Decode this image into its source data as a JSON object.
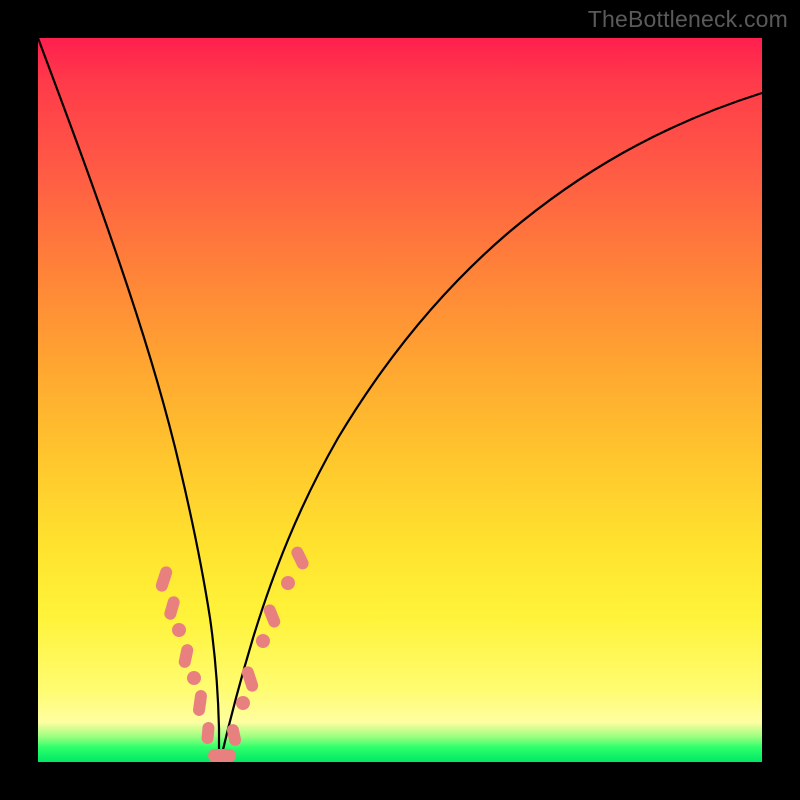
{
  "watermark": "TheBottleneck.com",
  "colors": {
    "frame": "#000000",
    "curve": "#000000",
    "marker": "#e98080",
    "gradient_stops": [
      "#ff1f4e",
      "#ff3a4a",
      "#ff5a45",
      "#ff8239",
      "#ffa531",
      "#ffc62d",
      "#ffe22e",
      "#fff33a",
      "#fffc71",
      "#fffea0",
      "#9bff80",
      "#2dff6b",
      "#00e865"
    ]
  },
  "chart_data": {
    "type": "line",
    "title": "",
    "xlabel": "",
    "ylabel": "",
    "xlim": [
      0,
      100
    ],
    "ylim": [
      0,
      100
    ],
    "x": [
      0,
      2,
      4,
      6,
      8,
      10,
      12,
      14,
      16,
      18,
      19,
      20,
      21,
      22,
      23,
      24,
      25,
      26,
      27,
      28,
      30,
      32,
      35,
      40,
      45,
      50,
      55,
      60,
      65,
      70,
      75,
      80,
      85,
      90,
      95,
      100
    ],
    "y": [
      100,
      88,
      77,
      67,
      58,
      50,
      42,
      35,
      28,
      21,
      18,
      15,
      12,
      9,
      6,
      3,
      0,
      3,
      6,
      9,
      14,
      19,
      25,
      34,
      42,
      48,
      54,
      59,
      63,
      67,
      71,
      74,
      77,
      80,
      82.5,
      85
    ],
    "minimum_x": 25,
    "highlighted_points": [
      {
        "x": 17.0,
        "y": 26
      },
      {
        "x": 18.0,
        "y": 22
      },
      {
        "x": 19.0,
        "y": 18
      },
      {
        "x": 20.0,
        "y": 14
      },
      {
        "x": 21.0,
        "y": 11
      },
      {
        "x": 22.5,
        "y": 7
      },
      {
        "x": 23.5,
        "y": 3
      },
      {
        "x": 25.0,
        "y": 0
      },
      {
        "x": 26.5,
        "y": 3
      },
      {
        "x": 28.0,
        "y": 8
      },
      {
        "x": 29.0,
        "y": 12
      },
      {
        "x": 30.5,
        "y": 16
      },
      {
        "x": 32.0,
        "y": 20
      },
      {
        "x": 34.0,
        "y": 25
      },
      {
        "x": 36.0,
        "y": 29
      }
    ],
    "series": [
      {
        "name": "bottleneck-curve",
        "note": "Single V-shaped curve; y=0 at the optimum, rising toward 100 on both sides. Background hue encodes y (green=low, red=high)."
      }
    ]
  }
}
